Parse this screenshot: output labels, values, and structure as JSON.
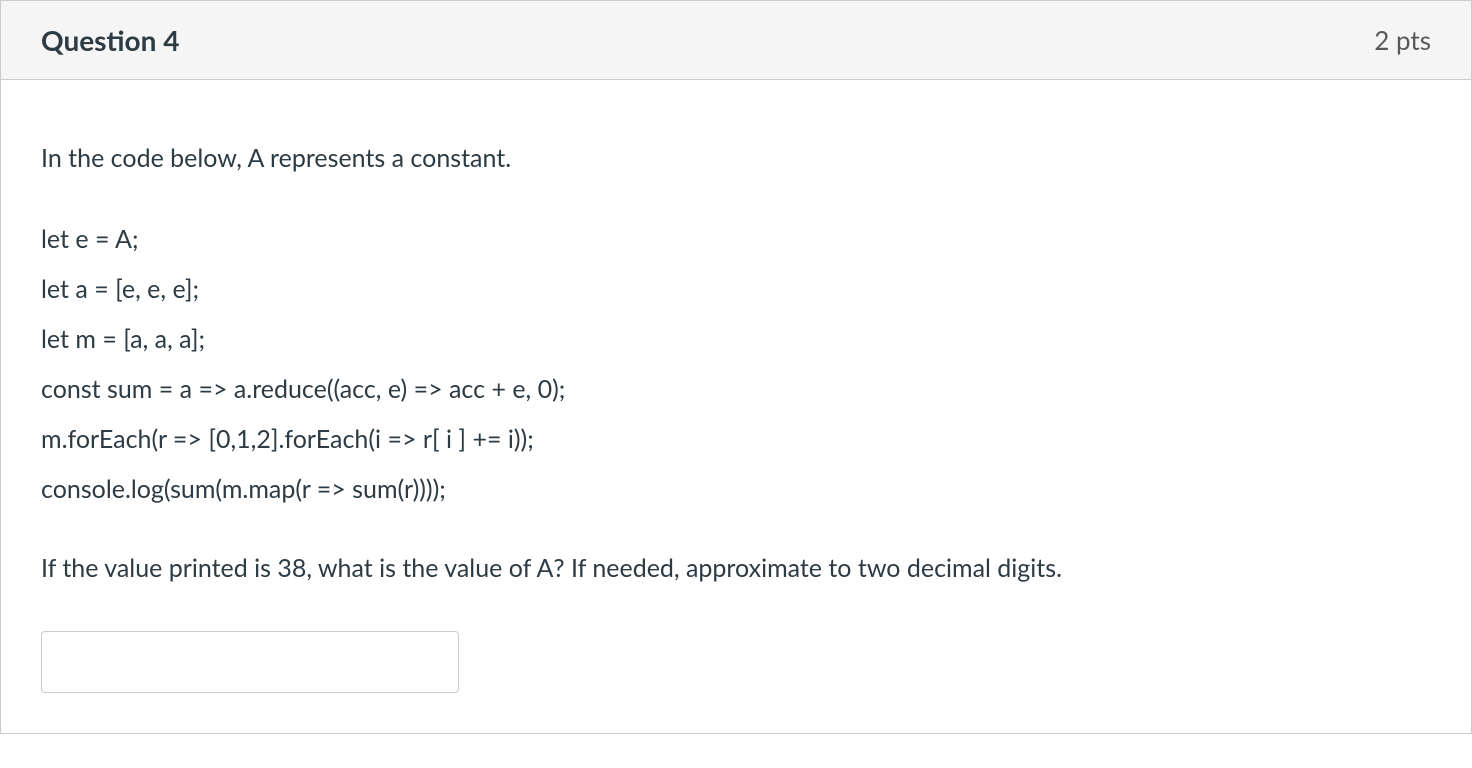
{
  "header": {
    "title": "Question 4",
    "points": "2 pts"
  },
  "body": {
    "intro": "In the code below, A represents a constant.",
    "code": [
      "let e = A;",
      "let a = [e, e, e];",
      "let m = [a, a, a];",
      "const sum = a => a.reduce((acc, e) => acc + e, 0);",
      "m.forEach(r => [0,1,2].forEach(i => r[ i ] += i));",
      "console.log(sum(m.map(r => sum(r))));"
    ],
    "followup": "If the value printed is 38, what is the value of A? If needed, approximate to two decimal digits.",
    "answer_value": ""
  }
}
